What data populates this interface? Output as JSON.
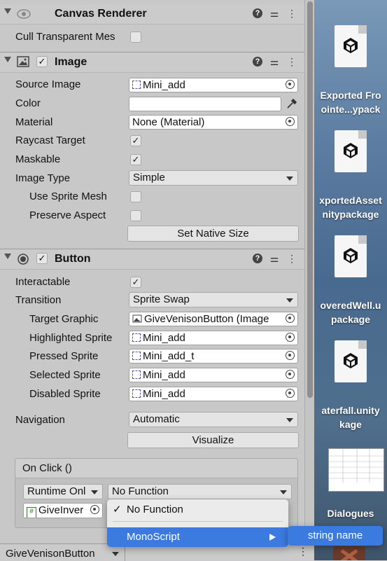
{
  "canvas_renderer": {
    "title": "Canvas Renderer",
    "cull_label": "Cull Transparent Mes"
  },
  "image": {
    "title": "Image",
    "source_image_label": "Source Image",
    "source_image_value": "Mini_add",
    "color_label": "Color",
    "material_label": "Material",
    "material_value": "None (Material)",
    "raycast_label": "Raycast Target",
    "maskable_label": "Maskable",
    "image_type_label": "Image Type",
    "image_type_value": "Simple",
    "use_sprite_mesh_label": "Use Sprite Mesh",
    "preserve_aspect_label": "Preserve Aspect",
    "set_native_size": "Set Native Size"
  },
  "button": {
    "title": "Button",
    "interactable_label": "Interactable",
    "transition_label": "Transition",
    "transition_value": "Sprite Swap",
    "target_graphic_label": "Target Graphic",
    "target_graphic_value": "GiveVenisonButton (Image",
    "highlighted_label": "Highlighted Sprite",
    "highlighted_value": "Mini_add",
    "pressed_label": "Pressed Sprite",
    "pressed_value": "Mini_add_t",
    "selected_label": "Selected Sprite",
    "selected_value": "Mini_add",
    "disabled_label": "Disabled Sprite",
    "disabled_value": "Mini_add",
    "navigation_label": "Navigation",
    "navigation_value": "Automatic",
    "visualize": "Visualize"
  },
  "on_click": {
    "title": "On Click ()",
    "runtime_value": "Runtime Onl",
    "function_value": "No Function",
    "object_value": "GiveInver"
  },
  "menu": {
    "item1": "No Function",
    "item1_check": "✓",
    "item2": "MonoScript",
    "submenu_item": "string name"
  },
  "bottom": {
    "object_name": "GiveVenisonButton"
  },
  "desktop": {
    "file1_line1": "Exported Fro",
    "file1_line2": "ointe...ypack",
    "file2_line1": "xportedAsset",
    "file2_line2": "nitypackage",
    "file3_line1": "overedWell.u",
    "file3_line2": "package",
    "file4_line1": "aterfall.unity",
    "file4_line2": "kage",
    "file5_label": "Dialogues"
  },
  "colors": {
    "highlight": "#3b7be0",
    "sprite_icon": "#5a4bb0"
  }
}
